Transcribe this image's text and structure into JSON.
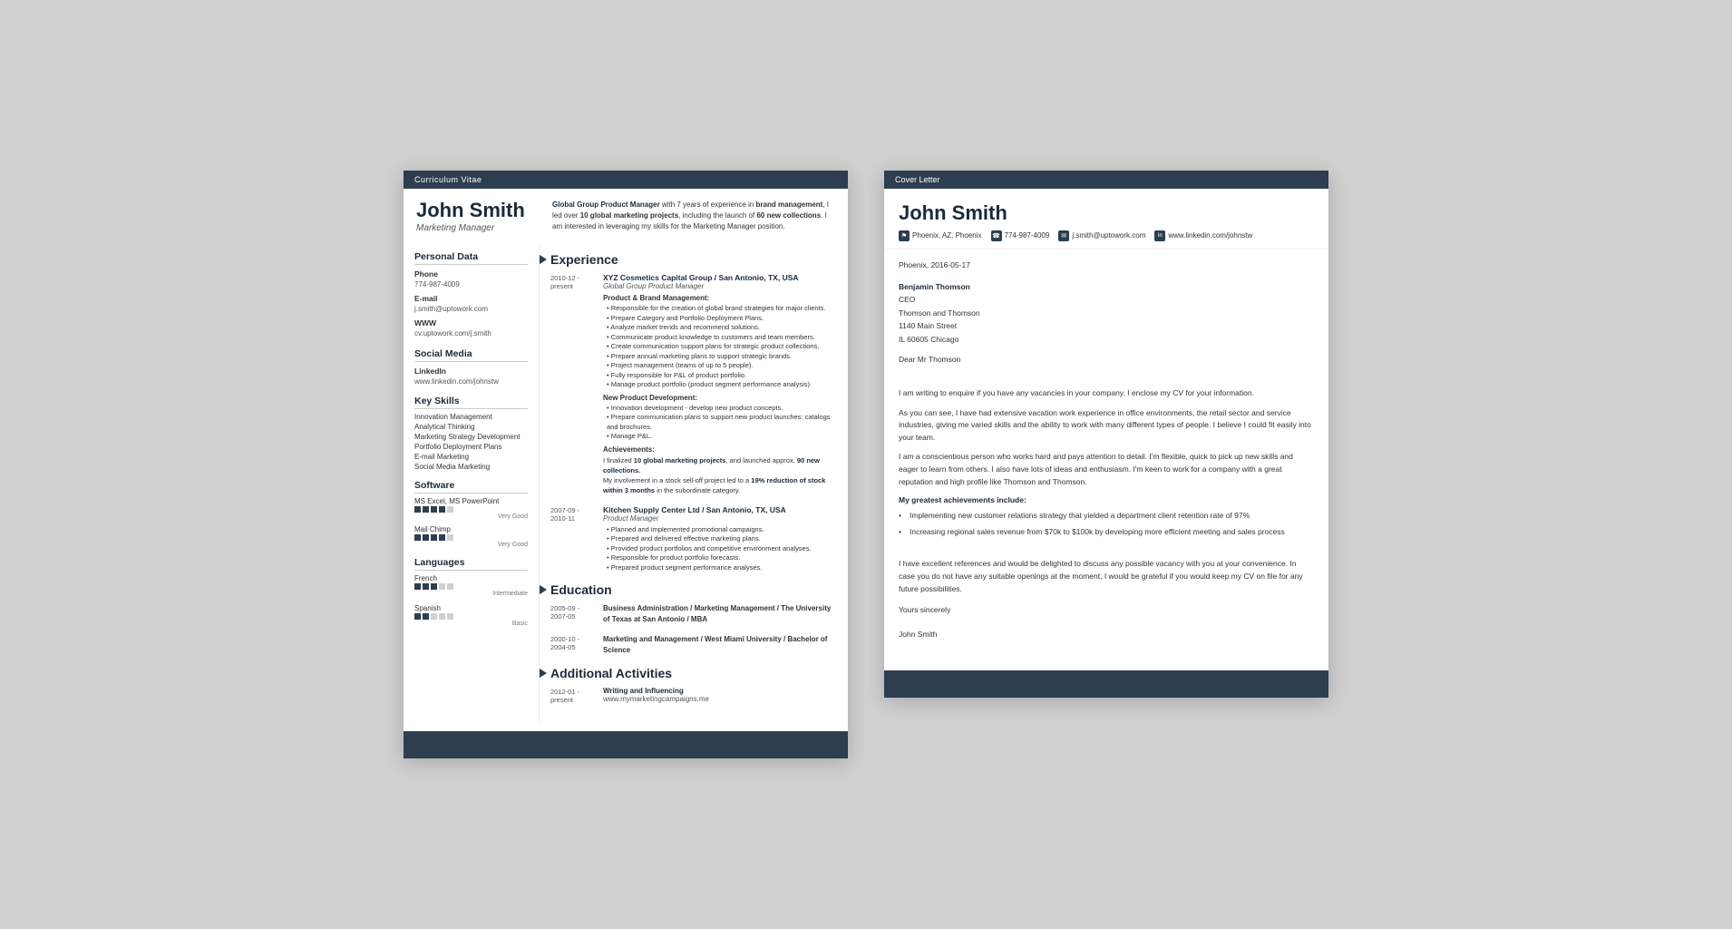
{
  "cv": {
    "header_bar": "Curriculum Vitae",
    "name": "John Smith",
    "title": "Marketing Manager",
    "summary": "Global Group Product Manager with 7 years of experience in brand management, I led over 10 global marketing projects, including the launch of 60 new collections. I am interested in leveraging my skills for the Marketing Manager position.",
    "sections": {
      "personal_data": "Personal Data",
      "social_media": "Social Media",
      "key_skills": "Key Skills",
      "software": "Software",
      "languages": "Languages"
    },
    "phone_label": "Phone",
    "phone_value": "774-987-4009",
    "email_label": "E-mail",
    "email_value": "j.smith@uptowork.com",
    "www_label": "WWW",
    "www_value": "cv.uptowork.com/j.smith",
    "linkedin_label": "LinkedIn",
    "linkedin_value": "www.linkedin.com/johnstw",
    "skills": [
      "Innovation Management",
      "Analytical Thinking",
      "Marketing Strategy Development",
      "Portfolio Deployment Plans",
      "E-mail Marketing",
      "Social Media Marketing"
    ],
    "software": [
      {
        "name": "MS Excel, MS PowerPoint",
        "level": 4,
        "max": 5,
        "label": "Very Good"
      },
      {
        "name": "Mail Chimp",
        "level": 4,
        "max": 5,
        "label": "Very Good"
      }
    ],
    "languages": [
      {
        "name": "French",
        "level": 3,
        "max": 5,
        "label": "Intermediate"
      },
      {
        "name": "Spanish",
        "level": 2,
        "max": 5,
        "label": "Basic"
      }
    ],
    "experience_heading": "Experience",
    "experience": [
      {
        "dates": "2010-12 - present",
        "company": "XYZ Cosmetics Capital Group / San Antonio, TX, USA",
        "role": "Global Group Product Manager",
        "sections": [
          {
            "heading": "Product & Brand Management:",
            "bullets": [
              "Responsible for the creation of global brand strategies for major clients.",
              "Prepare Category and Portfolio Deployment Plans.",
              "Analyze market trends and recommend solutions.",
              "Communicate product knowledge to customers and team members.",
              "Create communication support plans for strategic product collections.",
              "Prepare annual marketing plans to support strategic brands.",
              "Project management (teams of up to 5 people).",
              "Fully responsible for P&L of product portfolio.",
              "Manage product portfolio (product segment performance analysis)."
            ]
          },
          {
            "heading": "New Product Development:",
            "bullets": [
              "Innovation development - develop new product concepts.",
              "Prepare communication plans to support new product launches: catalogs and brochures.",
              "Manage P&L."
            ]
          },
          {
            "heading": "Achievements:",
            "achievement": "I finalized 10 global marketing projects, and launched approx. 90 new collections.\nMy involvement in a stock sell-off project led to a 19% reduction of stock within 3 months in the subordinate category."
          }
        ]
      },
      {
        "dates": "2007-09 - 2010-11",
        "company": "Kitchen Supply Center Ltd / San Antonio, TX, USA",
        "role": "Product Manager",
        "bullets": [
          "Planned and implemented promotional campaigns.",
          "Prepared and delivered effective marketing plans.",
          "Provided product portfolios and competitive environment analyses.",
          "Responsible for product portfolio forecasts.",
          "Prepared product segment performance analyses."
        ]
      }
    ],
    "education_heading": "Education",
    "education": [
      {
        "dates": "2005-09 - 2007-05",
        "degree": "Business Administration / Marketing Management / The University of Texas at San Antonio / MBA"
      },
      {
        "dates": "2000-10 - 2004-05",
        "degree": "Marketing and Management / West Miami University / Bachelor of Science"
      }
    ],
    "activities_heading": "Additional Activities",
    "activities": [
      {
        "dates": "2012-01 - present",
        "title": "Writing and Influencing",
        "url": "www.mymarketingcampaigns.me"
      }
    ]
  },
  "cover_letter": {
    "header_bar": "Cover Letter",
    "name": "John Smith",
    "contact": {
      "location": "Phoenix, AZ, Phoenix",
      "phone": "774-987-4009",
      "email": "j.smith@uptowork.com",
      "linkedin": "www.linkedin.com/johnstw"
    },
    "date": "Phoenix, 2016-05-17",
    "recipient": {
      "name": "Benjamin Thomson",
      "title": "CEO",
      "company": "Thomson and Thomson",
      "address": "1140 Main Street",
      "city": "IL 60605 Chicago"
    },
    "salutation": "Dear Mr Thomson",
    "paragraphs": [
      "I am writing to enquire if you have any vacancies in your company. I enclose my CV for your information.",
      "As you can see, I have had extensive vacation work experience in office environments, the retail sector and service industries, giving me varied skills and the ability to work with many different types of people. I believe I could fit easily into your team.",
      "I am a conscientious person who works hard and pays attention to detail. I'm flexible, quick to pick up new skills and eager to learn from others. I also have lots of ideas and enthusiasm. I'm keen to work for a company with a great reputation and high profile like Thomson and Thomson."
    ],
    "achievements_heading": "My greatest achievements include:",
    "achievements": [
      "Implementing new customer relations strategy that yielded a department client retention rate of 97%",
      "Increasing regional sales revenue from $70k to $100k by developing more efficient meeting and sales process"
    ],
    "closing_paragraph": "I have excellent references and would be delighted to discuss any possible vacancy with you at your convenience. In case you do not have any suitable openings at the moment, I would be grateful if you would keep my CV on file for any future possibilities.",
    "closing": "Yours sincerely",
    "signature": "John Smith"
  }
}
